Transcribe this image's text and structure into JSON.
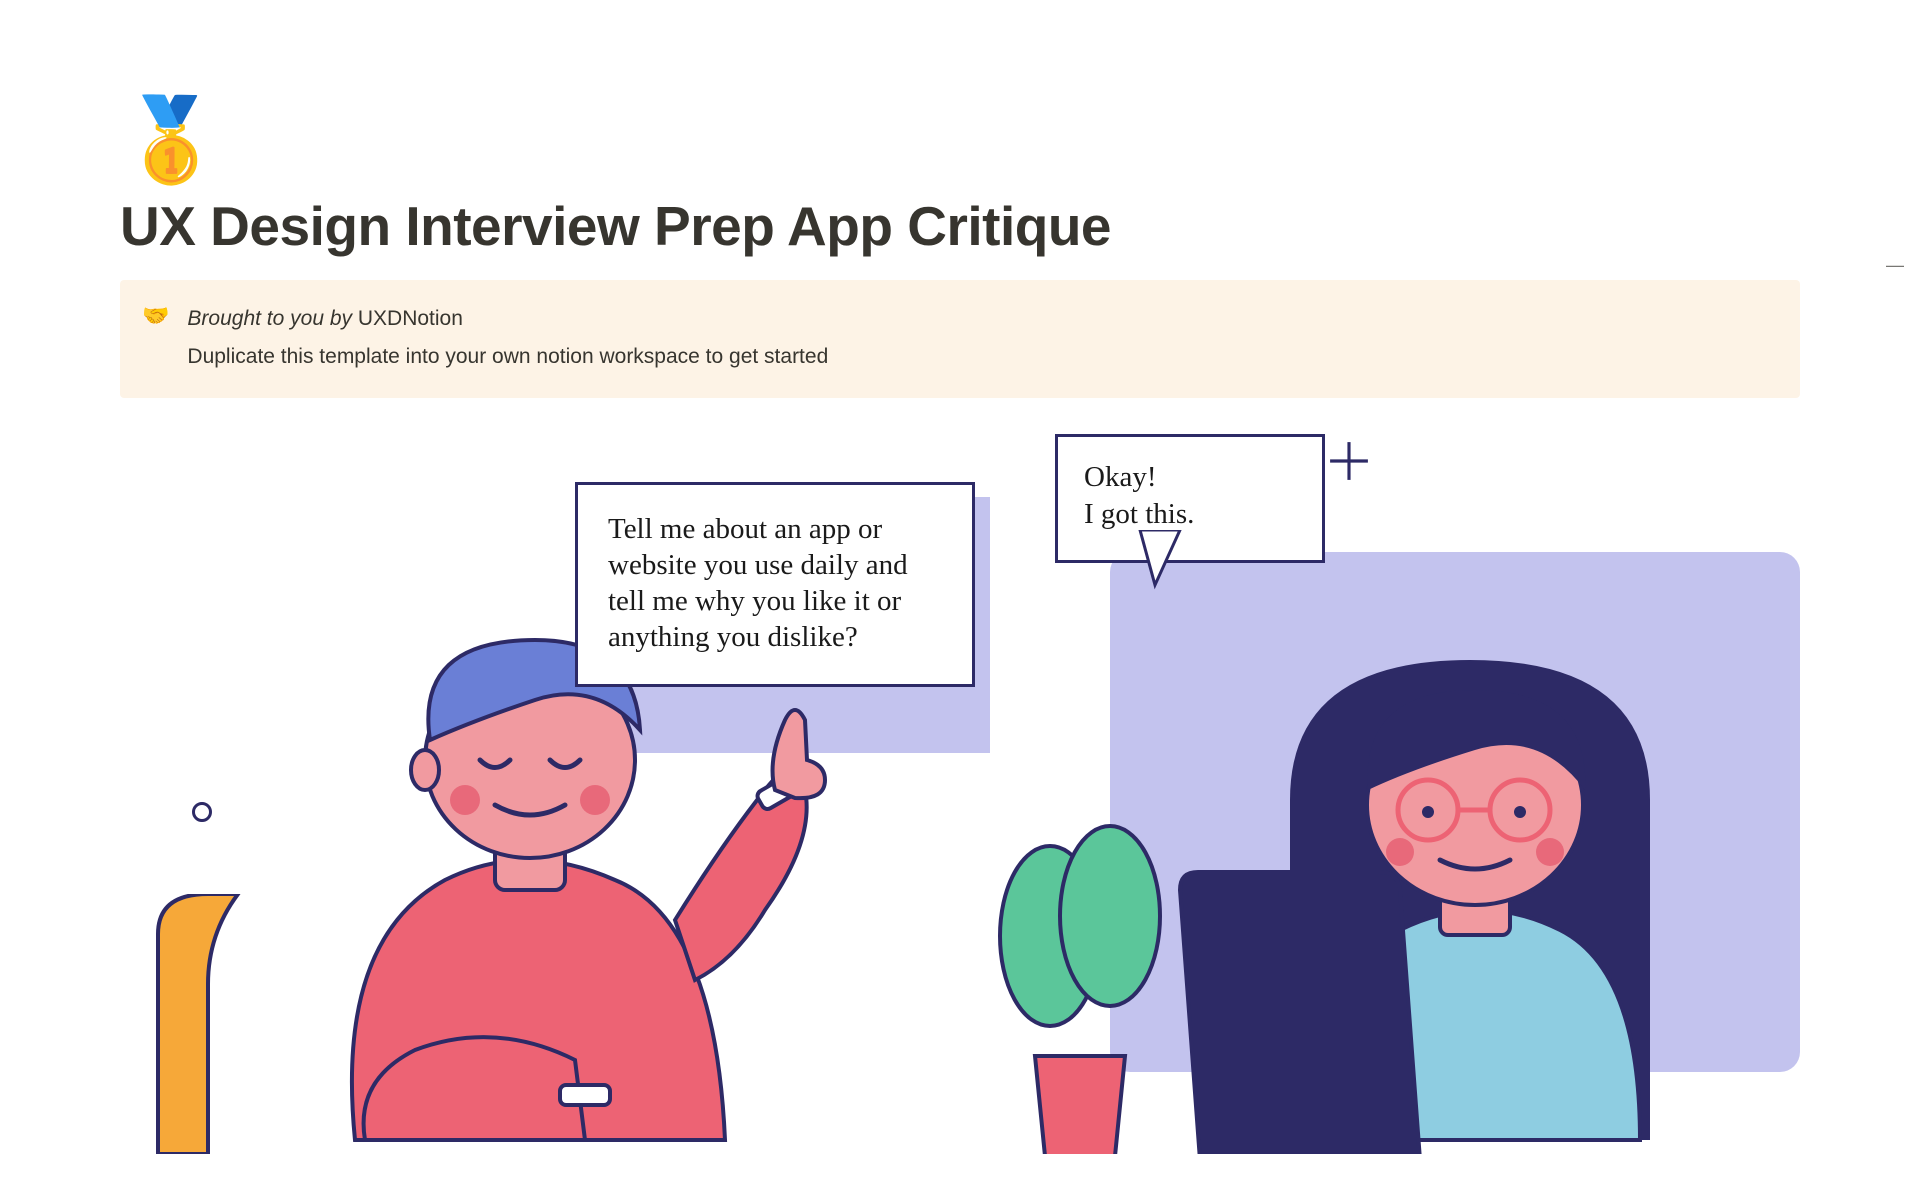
{
  "page": {
    "icon": "🥇",
    "title": "UX Design Interview Prep App Critique"
  },
  "callout": {
    "icon": "🤝",
    "byline_prefix": "Brought to you by ",
    "byline_author": "UXDNotion",
    "subtext": "Duplicate this template into your own notion workspace to get started"
  },
  "illustration": {
    "bubble1_text": "Tell me about an app or website you use daily and tell me why you like it or anything you dislike?",
    "bubble2_text": "Okay!\nI got this."
  },
  "rail": {
    "collapse": "—"
  }
}
